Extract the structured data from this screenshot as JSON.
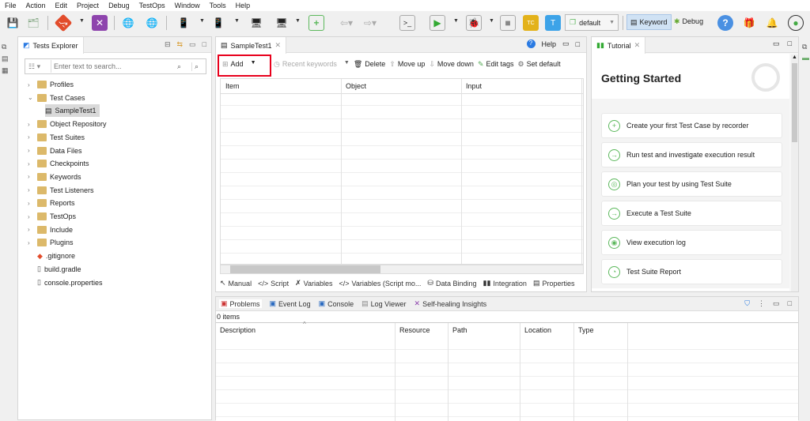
{
  "menu": [
    "File",
    "Action",
    "Edit",
    "Project",
    "Debug",
    "TestOps",
    "Window",
    "Tools",
    "Help"
  ],
  "toolbar": {
    "profile": "default",
    "keyword": "Keyword",
    "debug": "Debug"
  },
  "explorer": {
    "title": "Tests Explorer",
    "search_placeholder": "Enter text to search...",
    "items": [
      {
        "label": "Profiles",
        "level": 0,
        "expanded": false
      },
      {
        "label": "Test Cases",
        "level": 0,
        "expanded": true
      },
      {
        "label": "SampleTest1",
        "level": 1,
        "selected": true
      },
      {
        "label": "Object Repository",
        "level": 0
      },
      {
        "label": "Test Suites",
        "level": 0
      },
      {
        "label": "Data Files",
        "level": 0
      },
      {
        "label": "Checkpoints",
        "level": 0
      },
      {
        "label": "Keywords",
        "level": 0
      },
      {
        "label": "Test Listeners",
        "level": 0
      },
      {
        "label": "Reports",
        "level": 0
      },
      {
        "label": "TestOps",
        "level": 0
      },
      {
        "label": "Include",
        "level": 0
      },
      {
        "label": "Plugins",
        "level": 0
      },
      {
        "label": ".gitignore",
        "level": 0,
        "file": true
      },
      {
        "label": "build.gradle",
        "level": 0,
        "file": true
      },
      {
        "label": "console.properties",
        "level": 0,
        "file": true
      }
    ]
  },
  "editor": {
    "tab": "SampleTest1",
    "help": "Help",
    "actions": {
      "add": "Add",
      "recent": "Recent keywords",
      "delete": "Delete",
      "move_up": "Move up",
      "move_down": "Move down",
      "edit_tags": "Edit tags",
      "set_default": "Set default"
    },
    "columns": [
      "Item",
      "Object",
      "Input"
    ],
    "bottom_tabs": [
      "Manual",
      "Script",
      "Variables",
      "Variables (Script mo...",
      "Data Binding",
      "Integration",
      "Properties"
    ]
  },
  "tutorial": {
    "tab": "Tutorial",
    "title": "Getting Started",
    "cards": [
      "Create your first Test Case by recorder",
      "Run test and investigate execution result",
      "Plan your test by using Test Suite",
      "Execute a Test Suite",
      "View execution log",
      "Test Suite Report"
    ]
  },
  "problems": {
    "tabs": [
      "Problems",
      "Event Log",
      "Console",
      "Log Viewer",
      "Self-healing Insights"
    ],
    "count": "0 items",
    "columns": [
      "Description",
      "Resource",
      "Path",
      "Location",
      "Type"
    ]
  },
  "colors": {
    "accent": "#e8001c",
    "green": "#5cb85c"
  }
}
